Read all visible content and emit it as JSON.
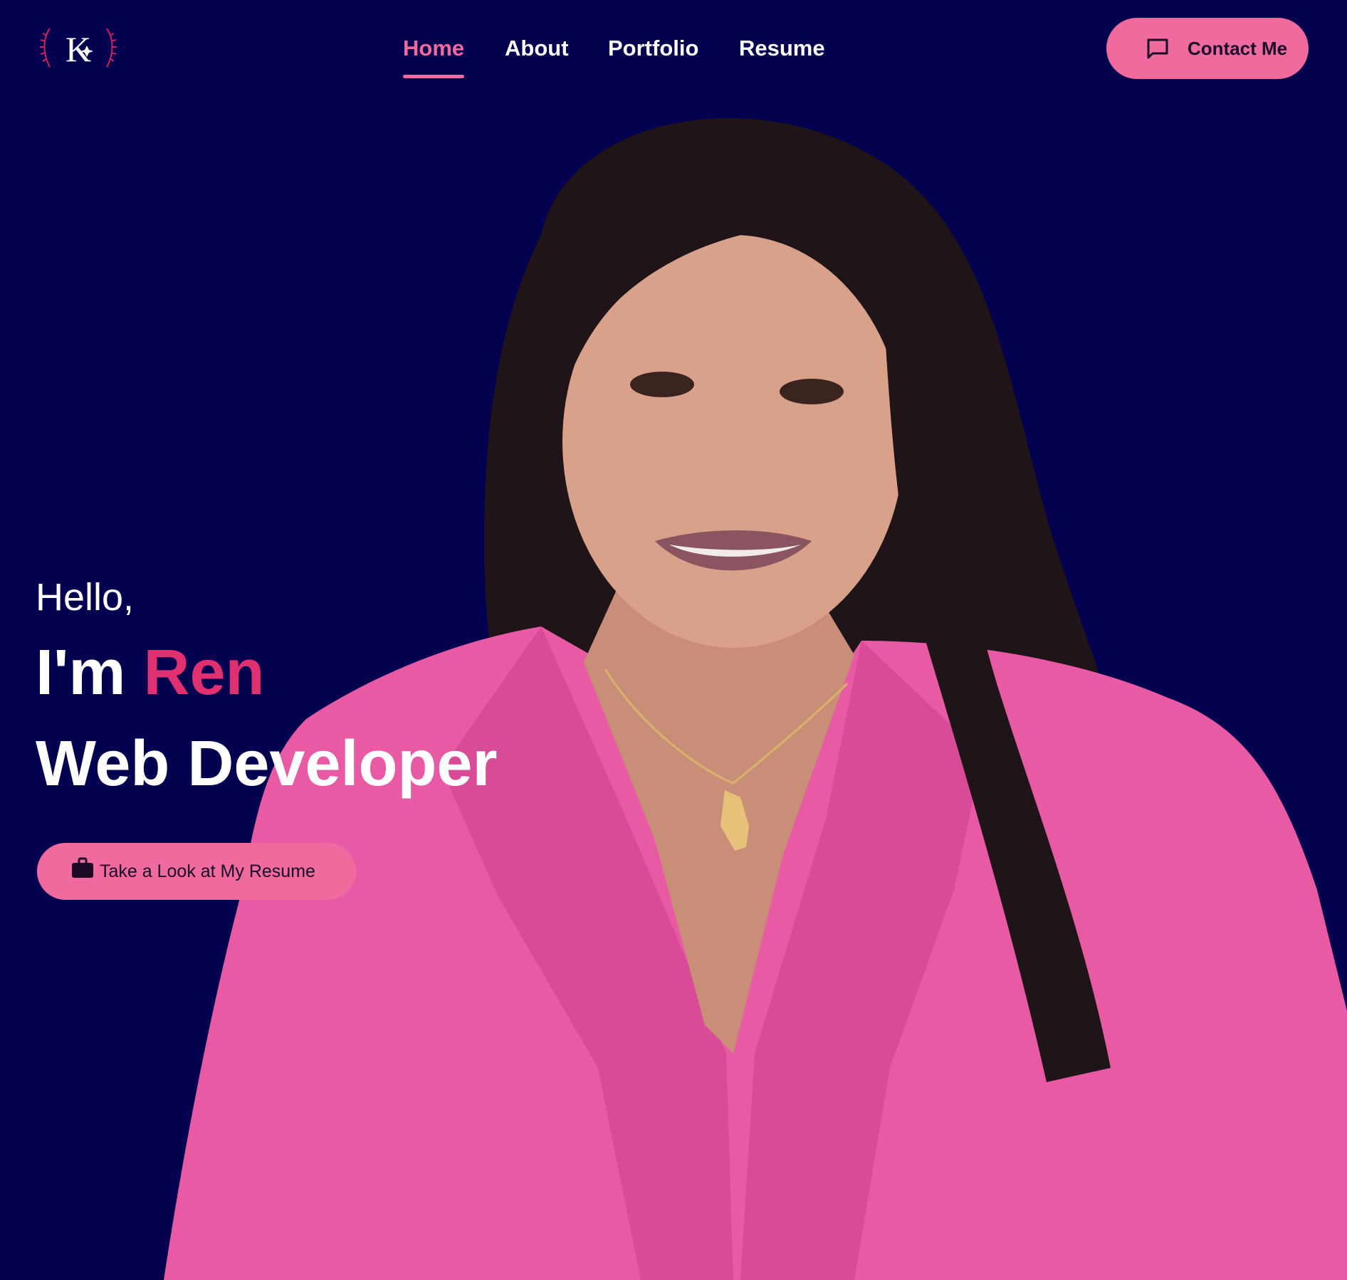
{
  "logo": {
    "letter": "K",
    "icon": "k-monogram-logo-icon"
  },
  "nav": {
    "items": [
      {
        "label": "Home",
        "active": true
      },
      {
        "label": "About",
        "active": false
      },
      {
        "label": "Portfolio",
        "active": false
      },
      {
        "label": "Resume",
        "active": false
      }
    ]
  },
  "header": {
    "contact_label": "Contact Me",
    "contact_icon": "chat-bubble-icon"
  },
  "hero": {
    "greeting": "Hello,",
    "intro_prefix": "I'm",
    "name": "Ren",
    "role": "Web Developer",
    "cta_label": "Take a Look at My Resume",
    "cta_icon": "briefcase-icon"
  },
  "colors": {
    "background": "#03004f",
    "accent_pink": "#ef6a9d",
    "name_pink": "#e0306f",
    "text_white": "#ffffff"
  }
}
